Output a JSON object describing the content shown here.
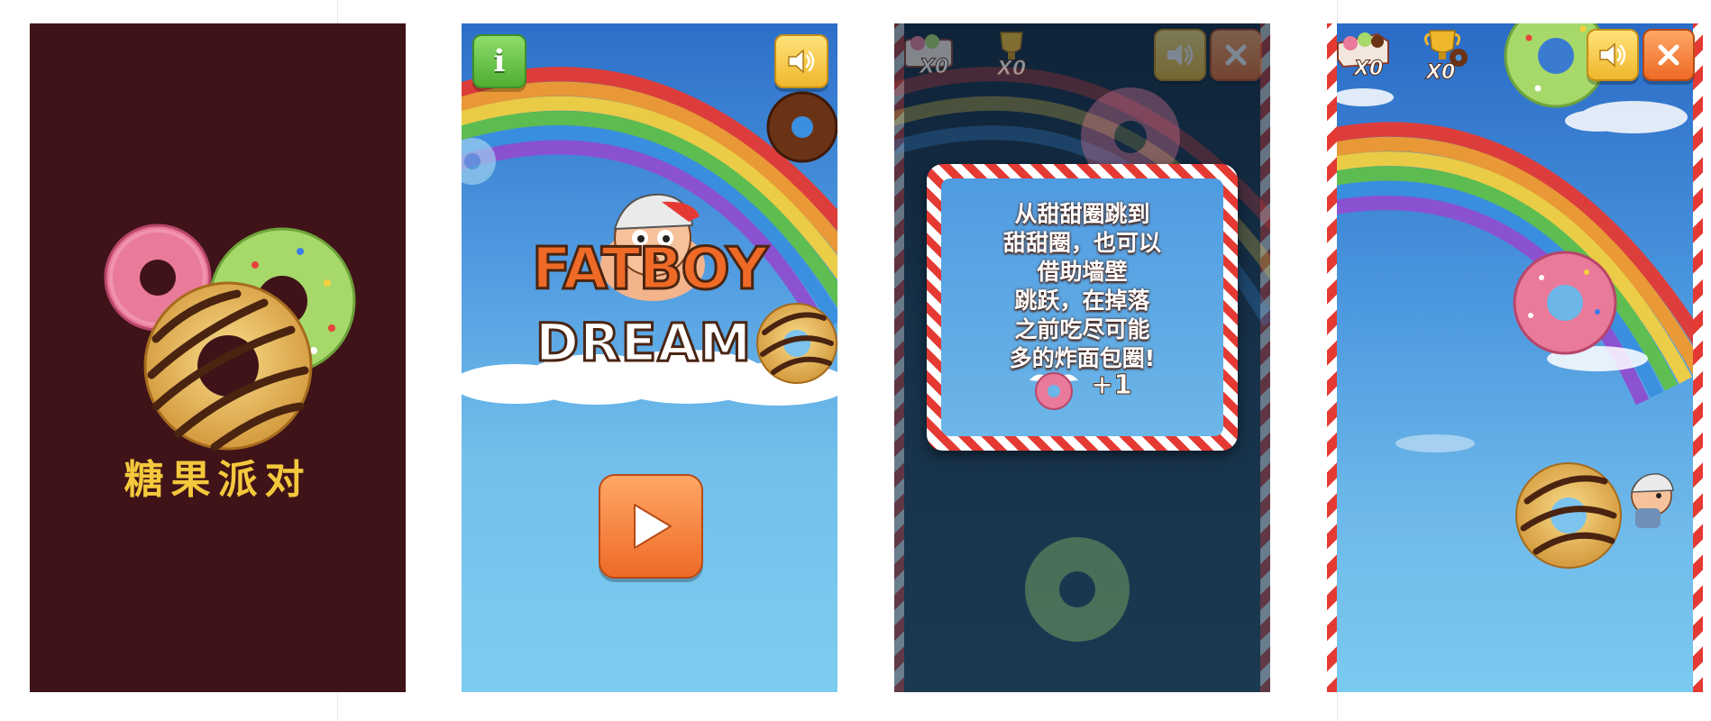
{
  "splash": {
    "title": "糖果派对",
    "background_color": "#3f1318",
    "title_color": "#f3c83c"
  },
  "menu": {
    "info_button_label": "i",
    "info_icon": "info-icon",
    "sound_icon": "speaker-icon",
    "logo_line1": "FATBOY",
    "logo_line2": "DREAM",
    "play_icon": "play-icon"
  },
  "tutorial": {
    "donut_counter": "X0",
    "trophy_counter": "X0",
    "sound_icon": "speaker-icon",
    "close_icon": "close-icon",
    "lines": [
      "从甜甜圈跳到",
      "甜甜圈，也可以",
      "借助墙壁",
      "跳跃，在掉落",
      "之前吃尽可能",
      "多的炸面包圈!"
    ],
    "reward_text": "+1"
  },
  "gameplay": {
    "donut_counter": "X0",
    "trophy_counter": "X0",
    "sound_icon": "speaker-icon",
    "close_icon": "close-icon"
  },
  "colors": {
    "accent_orange": "#ee6a26",
    "accent_yellow": "#f0b72c",
    "accent_green": "#4fae33",
    "stripe_red": "#e53a34"
  }
}
